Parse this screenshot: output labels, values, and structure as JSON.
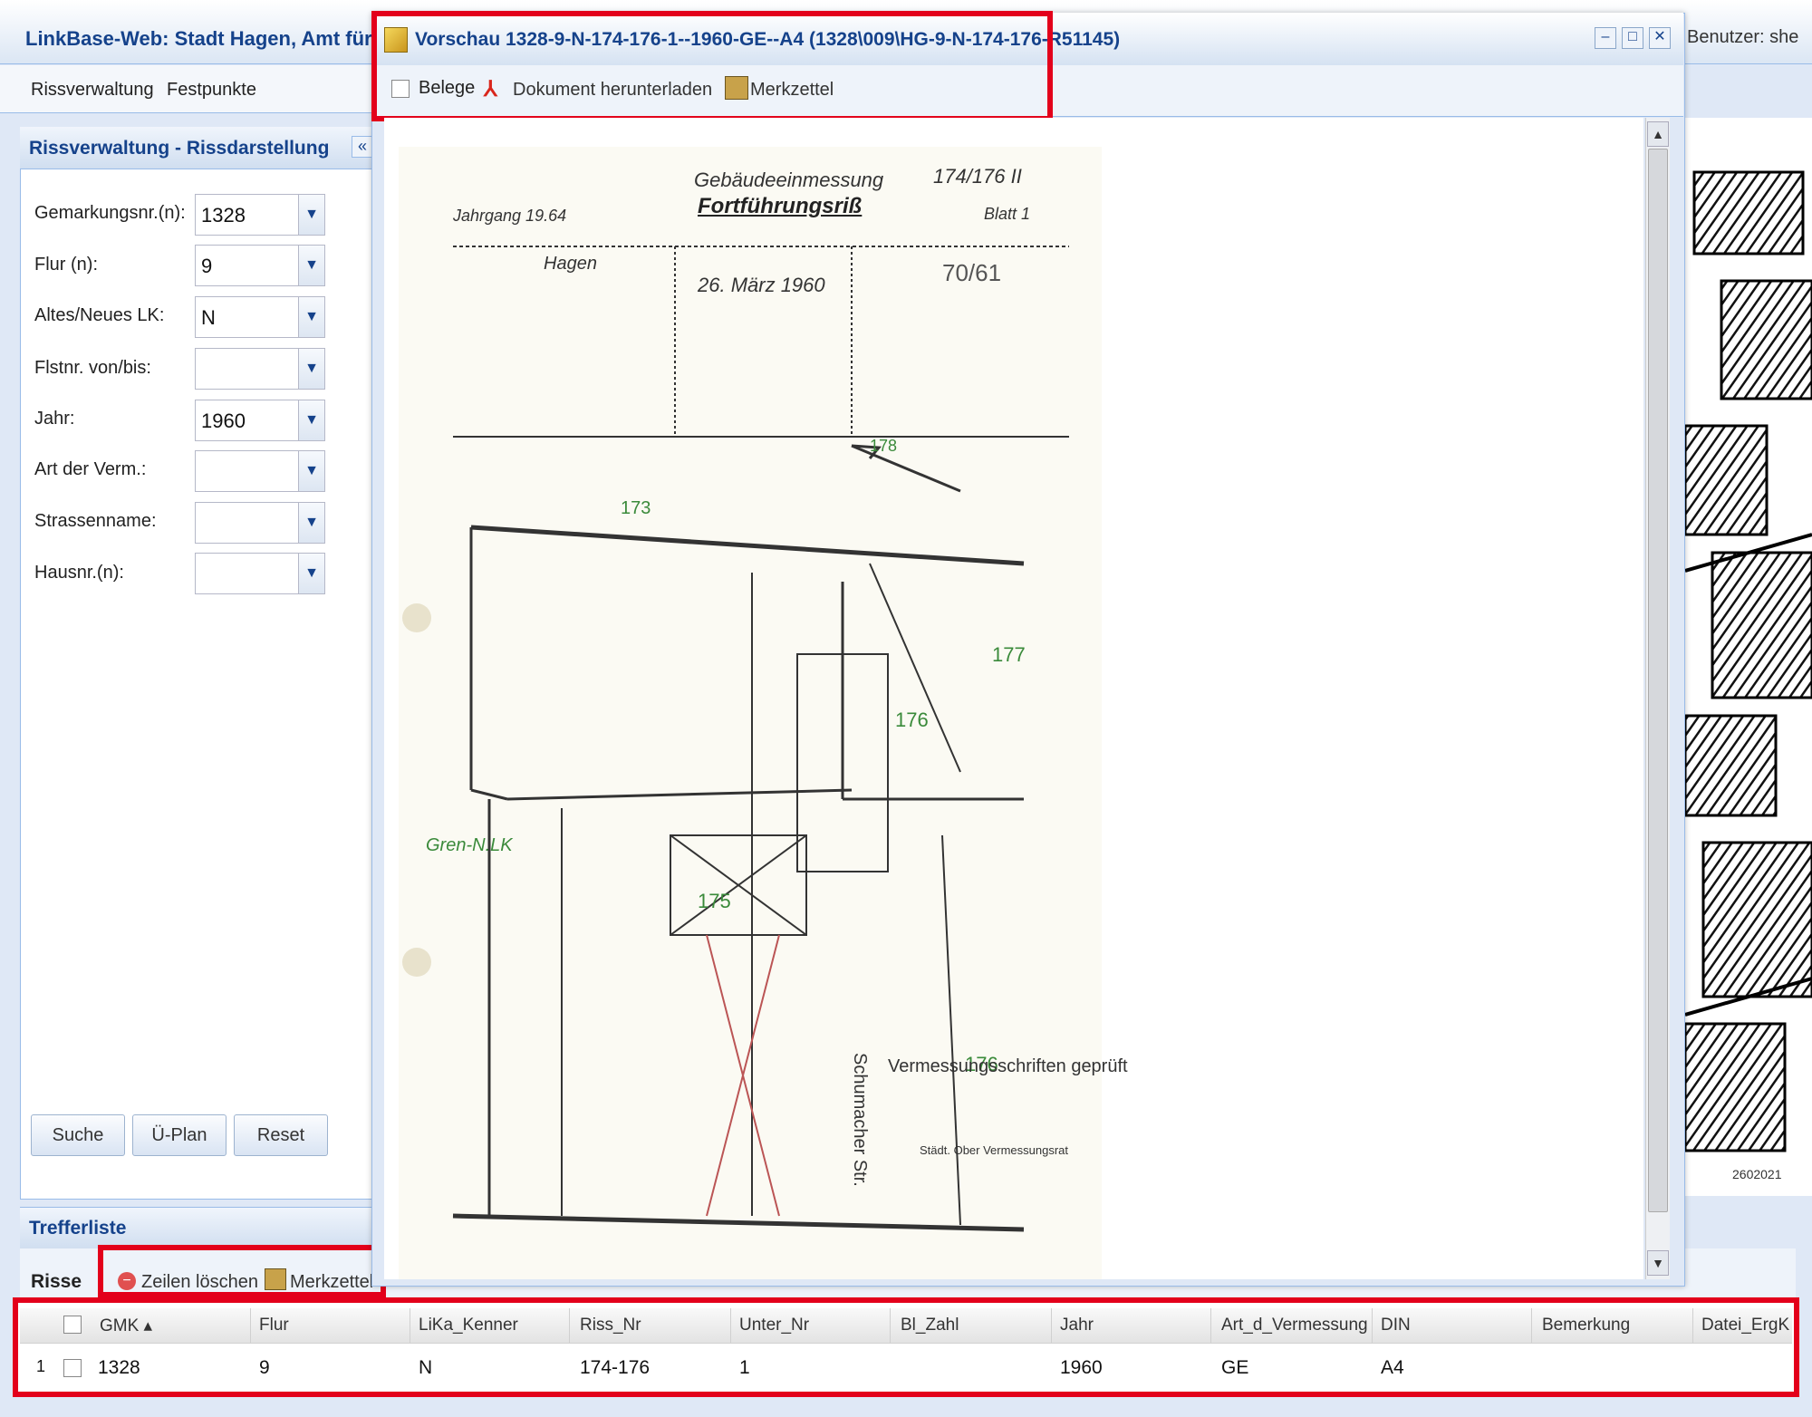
{
  "app": {
    "title": "LinkBase-Web: Stadt Hagen, Amt für Geo",
    "user": "Benutzer: she",
    "menu": [
      "Rissverwaltung",
      "Festpunkte"
    ]
  },
  "left_panel": {
    "title": "Rissverwaltung - Rissdarstellung",
    "collapse": "«",
    "fields": [
      {
        "label": "Gemarkungsnr.(n):",
        "value": "1328"
      },
      {
        "label": "Flur (n):",
        "value": "9"
      },
      {
        "label": "Altes/Neues LK:",
        "value": "N"
      },
      {
        "label": "Flstnr. von/bis:",
        "value": ""
      },
      {
        "label": "Jahr:",
        "value": "1960"
      },
      {
        "label": "Art der Verm.:",
        "value": ""
      },
      {
        "label": "Strassenname:",
        "value": ""
      },
      {
        "label": "Hausnr.(n):",
        "value": ""
      }
    ],
    "buttons": {
      "search": "Suche",
      "overview": "Ü-Plan",
      "reset": "Reset"
    }
  },
  "results": {
    "title": "Trefferliste",
    "tab": "Risse",
    "toolbar": {
      "delete_rows": "Zeilen löschen",
      "notes": "Merkzettel"
    },
    "columns": [
      "GMK ▴",
      "Flur",
      "LiKa_Kenner",
      "Riss_Nr",
      "Unter_Nr",
      "Bl_Zahl",
      "Jahr",
      "Art_d_Vermessung",
      "DIN",
      "Bemerkung",
      "Datei_ErgK"
    ],
    "rows": [
      {
        "index": "1",
        "cells": [
          "1328",
          "9",
          "N",
          "174-176",
          "1",
          "",
          "1960",
          "GE",
          "A4",
          "",
          ""
        ]
      }
    ]
  },
  "preview": {
    "title": "Vorschau 1328-9-N-174-176-1--1960-GE--A4 (1328\\009\\HG-9-N-174-176-R51145)",
    "toolbar": {
      "belege": "Belege",
      "download": "Dokument herunterladen",
      "notes": "Merkzettel"
    },
    "document": {
      "header": "Gebäudeeinmessung",
      "subheader": "Fortführungsriß",
      "number": "174/176 II",
      "year": "Jahrgang 19.64",
      "sheet": "Blatt 1",
      "place": "Hagen",
      "date": "26. März 1960",
      "order_no": "70/61",
      "stamp": "Vermessungsschriften geprüft",
      "stamp_sub": "Städt. Ober Vermessungsrat",
      "labels": [
        "177",
        "176",
        "175",
        "173",
        "178"
      ],
      "street": "Schumacher Str.",
      "note": "Gren-N.LK"
    },
    "map_label": "2602021"
  },
  "colors": {
    "accent": "#15428b",
    "highlight": "#e3001b"
  }
}
